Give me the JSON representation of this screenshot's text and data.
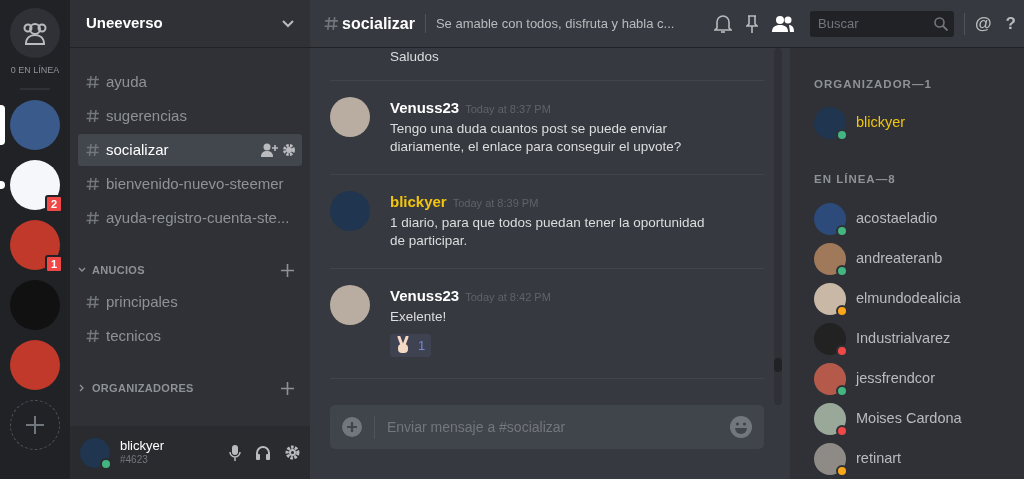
{
  "servers": {
    "online_label": "0 EN LÍNEA",
    "items": [
      {
        "selected": true,
        "unread": false
      },
      {
        "selected": false,
        "unread": true,
        "badge": "2"
      },
      {
        "selected": false,
        "unread": false,
        "badge": "1"
      },
      {
        "selected": false,
        "unread": false
      },
      {
        "selected": false,
        "unread": false
      }
    ]
  },
  "guild": {
    "name": "Uneeverso"
  },
  "channels": [
    {
      "kind": "channel",
      "name": "ayuda",
      "selected": false
    },
    {
      "kind": "channel",
      "name": "sugerencias",
      "selected": false
    },
    {
      "kind": "channel",
      "name": "socializar",
      "selected": true
    },
    {
      "kind": "channel",
      "name": "bienvenido-nuevo-steemer",
      "selected": false
    },
    {
      "kind": "channel",
      "name": "ayuda-registro-cuenta-ste...",
      "selected": false
    },
    {
      "kind": "category",
      "name": "ANUCIOS",
      "expanded": true,
      "children": [
        {
          "kind": "channel",
          "name": "principales",
          "selected": false
        },
        {
          "kind": "channel",
          "name": "tecnicos",
          "selected": false
        }
      ]
    },
    {
      "kind": "category",
      "name": "ORGANIZADORES",
      "expanded": false
    }
  ],
  "user_panel": {
    "name": "blickyer",
    "tag": "#4623",
    "color": "#43b581"
  },
  "header": {
    "channel": "socializar",
    "topic": "Se amable con todos, disfruta y habla c...",
    "search_placeholder": "Buscar",
    "mentions": "@",
    "help": "?"
  },
  "messages": [
    {
      "kind": "continued",
      "text": "Saludos"
    },
    {
      "kind": "group",
      "author": "Venuss23",
      "organizer": false,
      "time": "Today at 8:37 PM",
      "text": "Tengo una duda cuantos post se puede enviar diariamente, el enlace para conseguir el upvote?"
    },
    {
      "kind": "group",
      "author": "blickyer",
      "organizer": true,
      "time": "Today at 8:39 PM",
      "text": "1 diario, para que todos puedan tener la oportunidad de participar."
    },
    {
      "kind": "group",
      "author": "Venuss23",
      "organizer": false,
      "time": "Today at 8:42 PM",
      "text": "Exelente!",
      "reactions": [
        {
          "count": "1"
        }
      ]
    }
  ],
  "composer": {
    "placeholder": "Enviar mensaje a #socializar"
  },
  "member_groups": [
    {
      "title": "ORGANIZADOR—1",
      "members": [
        {
          "name": "blickyer",
          "organizer": true,
          "color": "#43b581"
        }
      ]
    },
    {
      "title": "EN LÍNEA—8",
      "members": [
        {
          "name": "acostaeladio",
          "organizer": false,
          "color": "#43b581"
        },
        {
          "name": "andreateranb",
          "organizer": false,
          "color": "#43b581"
        },
        {
          "name": "elmundodealicia",
          "organizer": false,
          "color": "#faa61a"
        },
        {
          "name": "Industrialvarez",
          "organizer": false,
          "color": "#f04747"
        },
        {
          "name": "jessfrendcor",
          "organizer": false,
          "color": "#43b581"
        },
        {
          "name": "Moises Cardona",
          "organizer": false,
          "color": "#f04747"
        },
        {
          "name": "retinart",
          "organizer": false,
          "color": "#faa61a"
        }
      ]
    }
  ]
}
